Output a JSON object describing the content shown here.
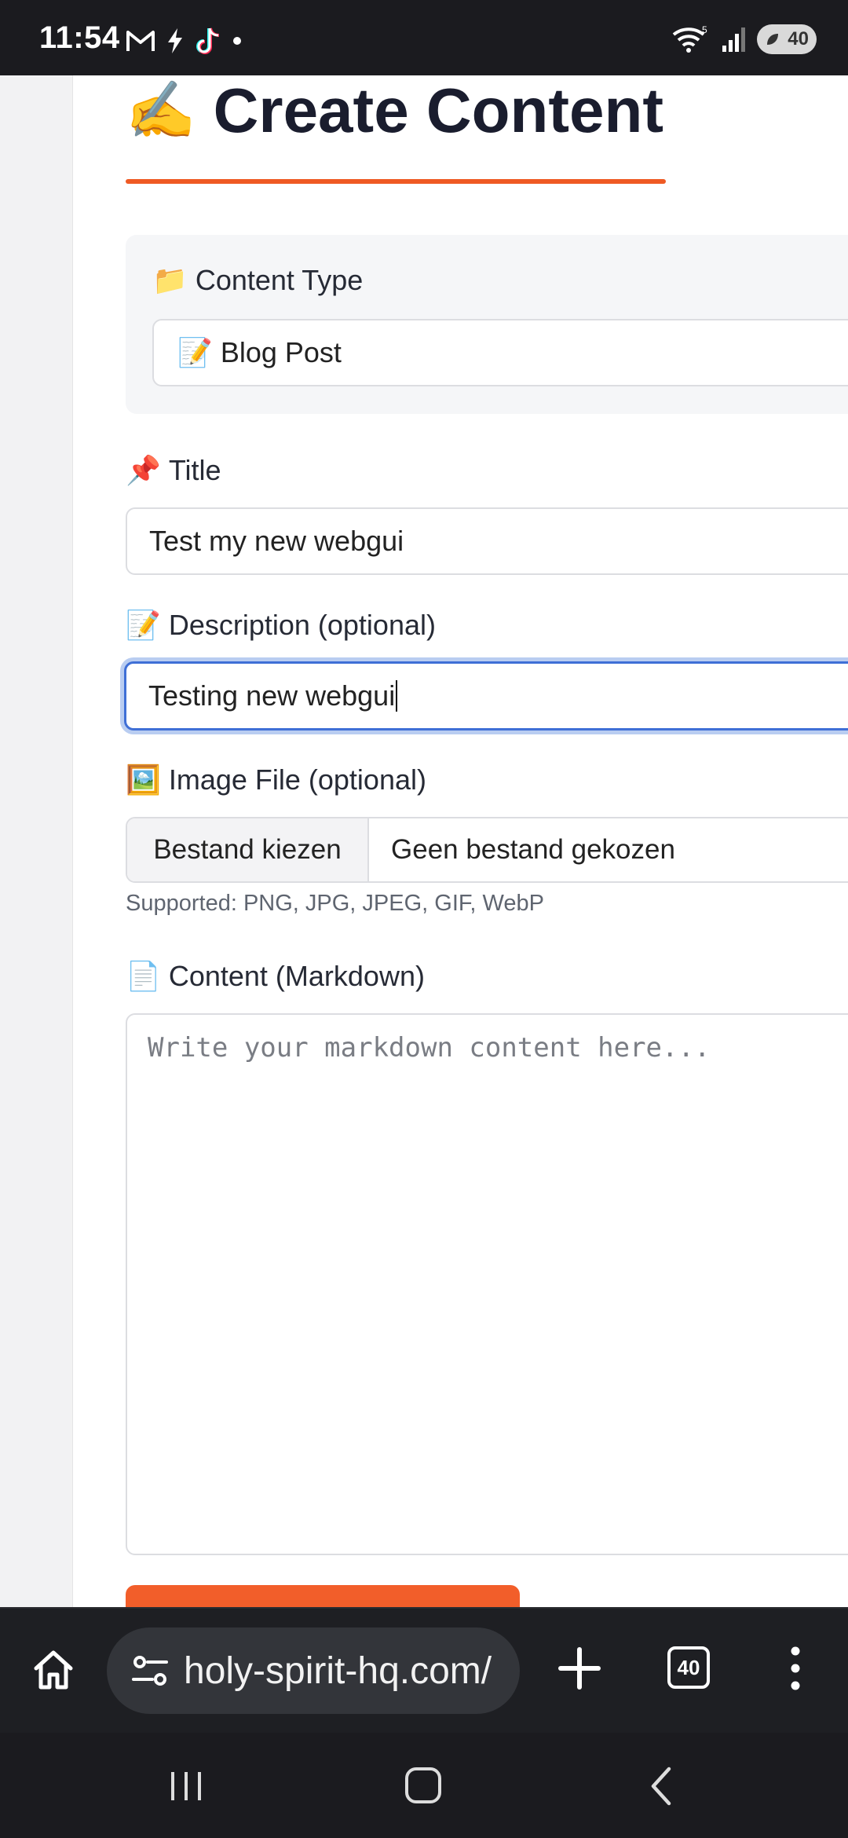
{
  "status_bar": {
    "time": "11:54",
    "battery": "40",
    "icons": [
      "gmail-icon",
      "bolt-icon",
      "tiktok-icon",
      "dot-icon",
      "wifi-icon",
      "signal-icon",
      "battery-icon"
    ]
  },
  "page": {
    "heading": "Create Content",
    "heading_emoji": "✍️",
    "accent_color": "#ef5a24",
    "content_type": {
      "label": "Content Type",
      "label_emoji": "📁",
      "selected": "📝 Blog Post"
    },
    "title_field": {
      "label": "Title",
      "label_emoji": "📌",
      "value": "Test my new webgui"
    },
    "description_field": {
      "label": "Description (optional)",
      "label_emoji": "📝",
      "value": "Testing new webgui"
    },
    "image_field": {
      "label": "Image File (optional)",
      "label_emoji": "🖼️",
      "button_label": "Bestand kiezen",
      "file_name": "Geen bestand gekozen",
      "hint": "Supported: PNG, JPG, JPEG, GIF, WebP"
    },
    "content_field": {
      "label": "Content (Markdown)",
      "label_emoji": "📄",
      "placeholder": "Write your markdown content here..."
    }
  },
  "browser": {
    "url": "holy-spirit-hq.com/",
    "tab_count": "40"
  }
}
